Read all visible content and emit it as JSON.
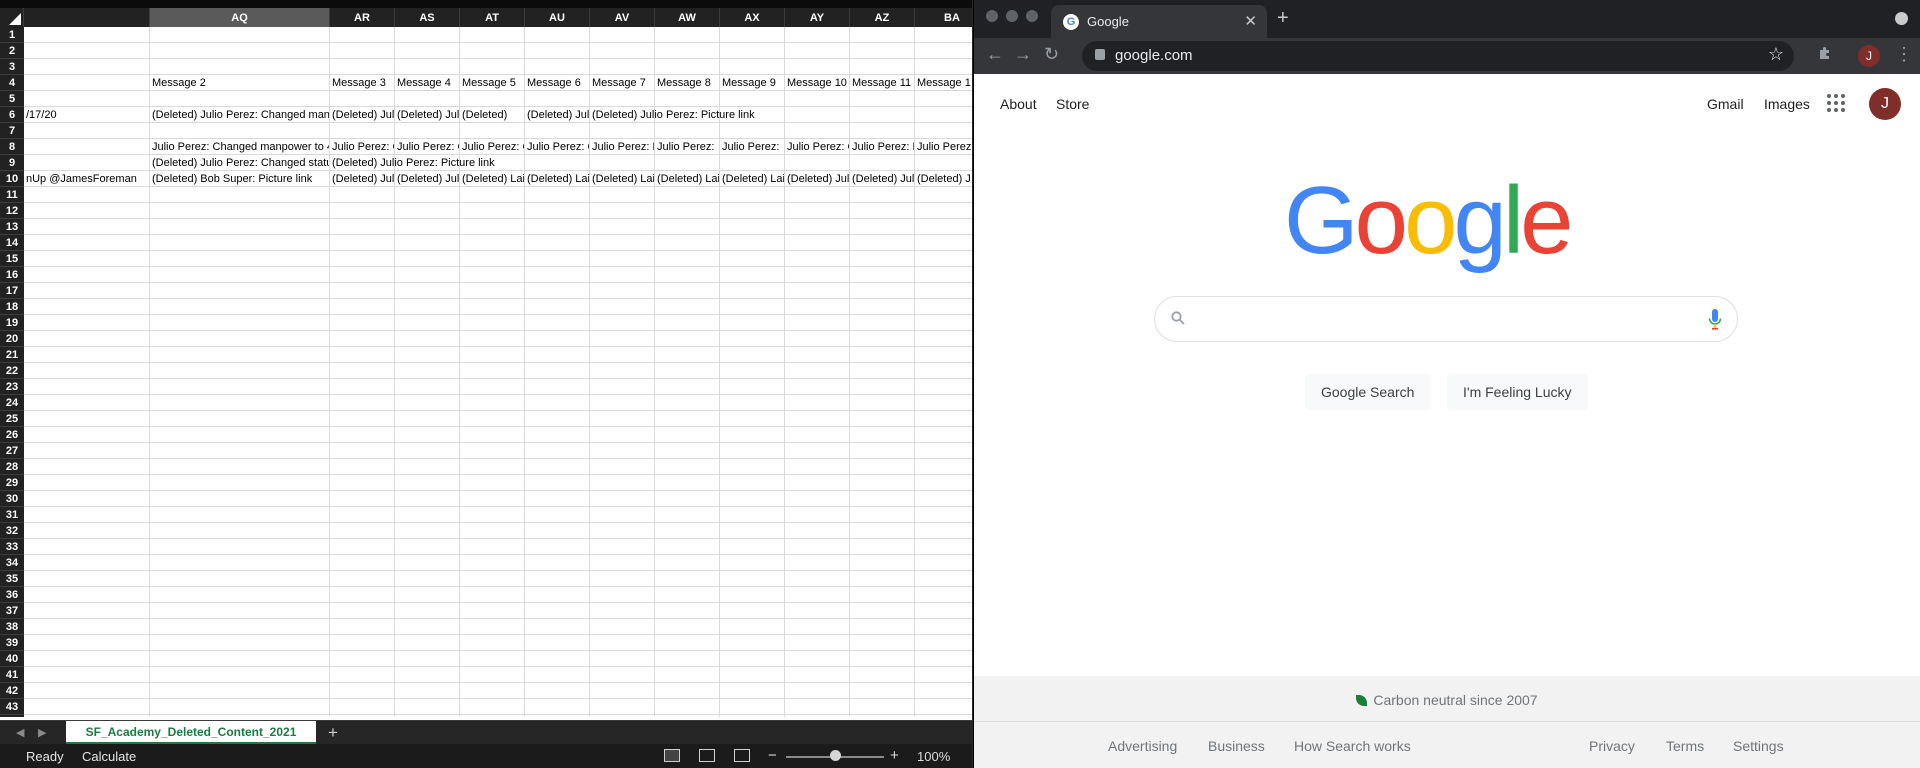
{
  "spreadsheet": {
    "columns": [
      {
        "label": "",
        "selected": false
      },
      {
        "label": "AQ",
        "selected": true
      },
      {
        "label": "AR",
        "selected": false
      },
      {
        "label": "AS",
        "selected": false
      },
      {
        "label": "AT",
        "selected": false
      },
      {
        "label": "AU",
        "selected": false
      },
      {
        "label": "AV",
        "selected": false
      },
      {
        "label": "AW",
        "selected": false
      },
      {
        "label": "AX",
        "selected": false
      },
      {
        "label": "AY",
        "selected": false
      },
      {
        "label": "AZ",
        "selected": false
      },
      {
        "label": "BA",
        "selected": false
      }
    ],
    "row_count": 43,
    "rows": {
      "4": [
        "",
        "Message 2",
        "Message 3",
        "Message 4",
        "Message 5",
        "Message 6",
        "Message 7",
        "Message 8",
        "Message 9",
        "Message 10",
        "Message 11",
        "Message 1"
      ],
      "6": [
        "/17/20",
        "(Deleted) Julio Perez: Changed manp",
        "(Deleted) Jul",
        "(Deleted) Jul",
        "(Deleted)",
        "(Deleted) Jul",
        "(Deleted) Julio Perez: Picture link",
        "",
        "",
        "",
        "",
        ""
      ],
      "8": [
        "",
        "Julio Perez: Changed manpower to 4",
        "Julio Perez: C",
        "Julio Perez: C",
        "Julio Perez: C",
        "Julio Perez: C",
        "Julio Perez: F",
        "Julio Perez:",
        "Julio Perez:",
        "Julio Perez: C",
        "Julio Perez: F",
        "Julio Perez:"
      ],
      "9": [
        "",
        "(Deleted) Julio Perez: Changed statu",
        "(Deleted) Julio Perez: Picture link",
        "",
        "",
        "",
        "",
        "",
        "",
        "",
        "",
        ""
      ],
      "10": [
        "nUp @JamesForeman",
        "(Deleted) Bob Super: Picture link",
        "(Deleted) Jul",
        "(Deleted) Jul",
        "(Deleted) Lai",
        "(Deleted) Lai",
        "(Deleted) Lai",
        "(Deleted) Lai",
        "(Deleted) Lai",
        "(Deleted) Jul",
        "(Deleted) Jul",
        "(Deleted) J"
      ]
    },
    "sheet_tab": "SF_Academy_Deleted_Content_2021",
    "add_sheet": "+",
    "status_ready": "Ready",
    "status_calculate": "Calculate",
    "zoom_minus": "−",
    "zoom_plus": "+",
    "zoom_level": "100%",
    "zoom_fraction": 0.5
  },
  "browser": {
    "tab_title": "Google",
    "tab_close": "✕",
    "new_tab": "+",
    "url": "google.com",
    "back": "←",
    "forward": "→",
    "reload": "↻",
    "star": "☆",
    "menu": "⋮",
    "profile_initial": "J"
  },
  "google": {
    "about": "About",
    "store": "Store",
    "gmail": "Gmail",
    "images": "Images",
    "avatar_initial": "J",
    "logo_letters": [
      {
        "ch": "G",
        "color": "#4285F4"
      },
      {
        "ch": "o",
        "color": "#EA4335"
      },
      {
        "ch": "o",
        "color": "#FBBC05"
      },
      {
        "ch": "g",
        "color": "#4285F4"
      },
      {
        "ch": "l",
        "color": "#34A853"
      },
      {
        "ch": "e",
        "color": "#EA4335"
      }
    ],
    "search_value": "",
    "search_button": "Google Search",
    "lucky_button": "I'm Feeling Lucky",
    "carbon": "Carbon neutral since 2007",
    "footer_left": [
      "Advertising",
      "Business",
      "How Search works"
    ],
    "footer_right": [
      "Privacy",
      "Terms",
      "Settings"
    ]
  }
}
